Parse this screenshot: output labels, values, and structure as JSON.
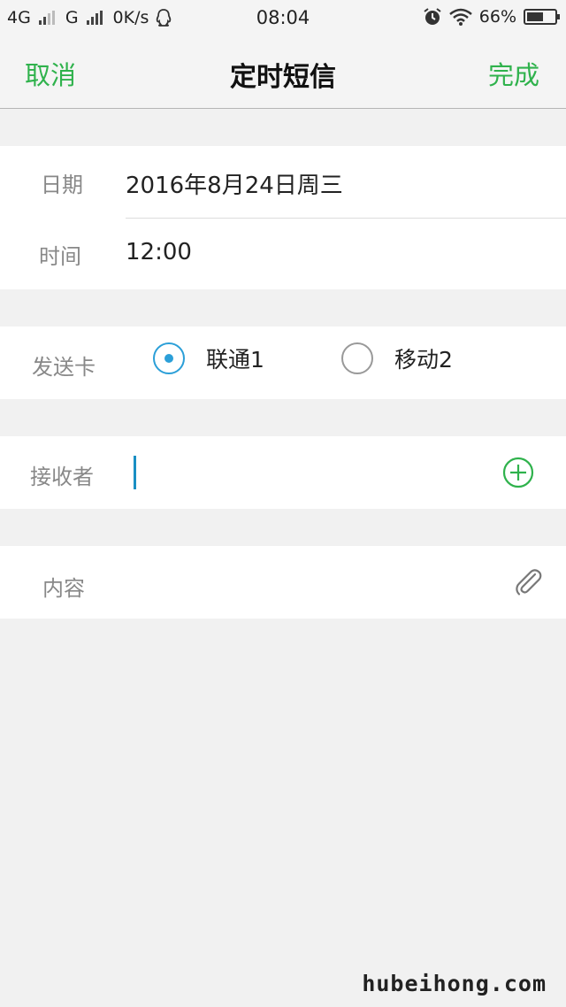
{
  "status_bar": {
    "network_1": "4G",
    "network_2": "G",
    "speed": "0K/s",
    "time": "08:04",
    "battery_percent": "66%",
    "battery_level": 0.66
  },
  "nav": {
    "cancel_label": "取消",
    "title": "定时短信",
    "done_label": "完成",
    "accent_color": "#2fb24c"
  },
  "schedule": {
    "date_label": "日期",
    "date_value": "2016年8月24日周三",
    "time_label": "时间",
    "time_value": "12:00"
  },
  "sim": {
    "label": "发送卡",
    "options": [
      {
        "label": "联通1",
        "selected": true
      },
      {
        "label": "移动2",
        "selected": false
      }
    ],
    "selected_color": "#2b9fd8"
  },
  "recipient": {
    "label": "接收者",
    "value": "",
    "add_icon": "plus-circle-icon"
  },
  "content": {
    "label": "内容",
    "attach_icon": "paperclip-icon"
  },
  "watermark": "hubeihong.com"
}
